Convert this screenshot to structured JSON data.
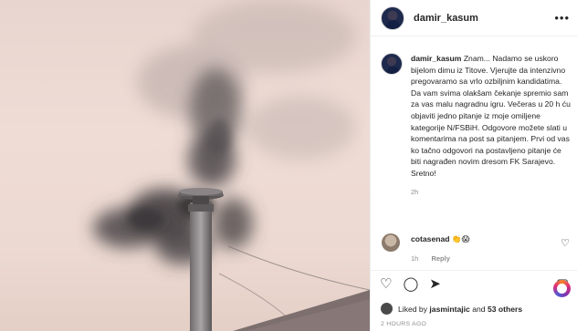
{
  "post": {
    "username": "damir_kasum",
    "more_icon": "ellipsis-icon",
    "caption": "Znam... Nadamo se uskoro bijelom dimu iz Titove. Vjerujte da intenzivno pregovaramo sa vrlo ozbiljnim kandidatima. Da vam svima olakšam čekanje spremio sam za vas malu nagradnu igru. Večeras u 20 h ću objaviti jedno pitanje iz moje omiljene kategorije N/FSBiH. Odgovore možete slati u komentarima na post sa pitanjem. Prvi od vas ko tačno odgovori na postavljeno pitanje će biti nagrađen novim dresom FK Sarajevo. Sretno!",
    "caption_time": "2h"
  },
  "comment": {
    "username": "cotasenad",
    "text": "👏😱",
    "time": "1h",
    "reply": "Reply"
  },
  "actions": {
    "like": "♡",
    "comment": "◯",
    "share": "➤",
    "save": "▢"
  },
  "likes": {
    "prefix": "Liked by",
    "user": "jasmintajic",
    "middle": "and",
    "others": "53 others"
  },
  "timestamp": "2 HOURS AGO",
  "colors": {
    "text": "#262626",
    "muted": "#8e8e8e",
    "border": "#efefef"
  }
}
